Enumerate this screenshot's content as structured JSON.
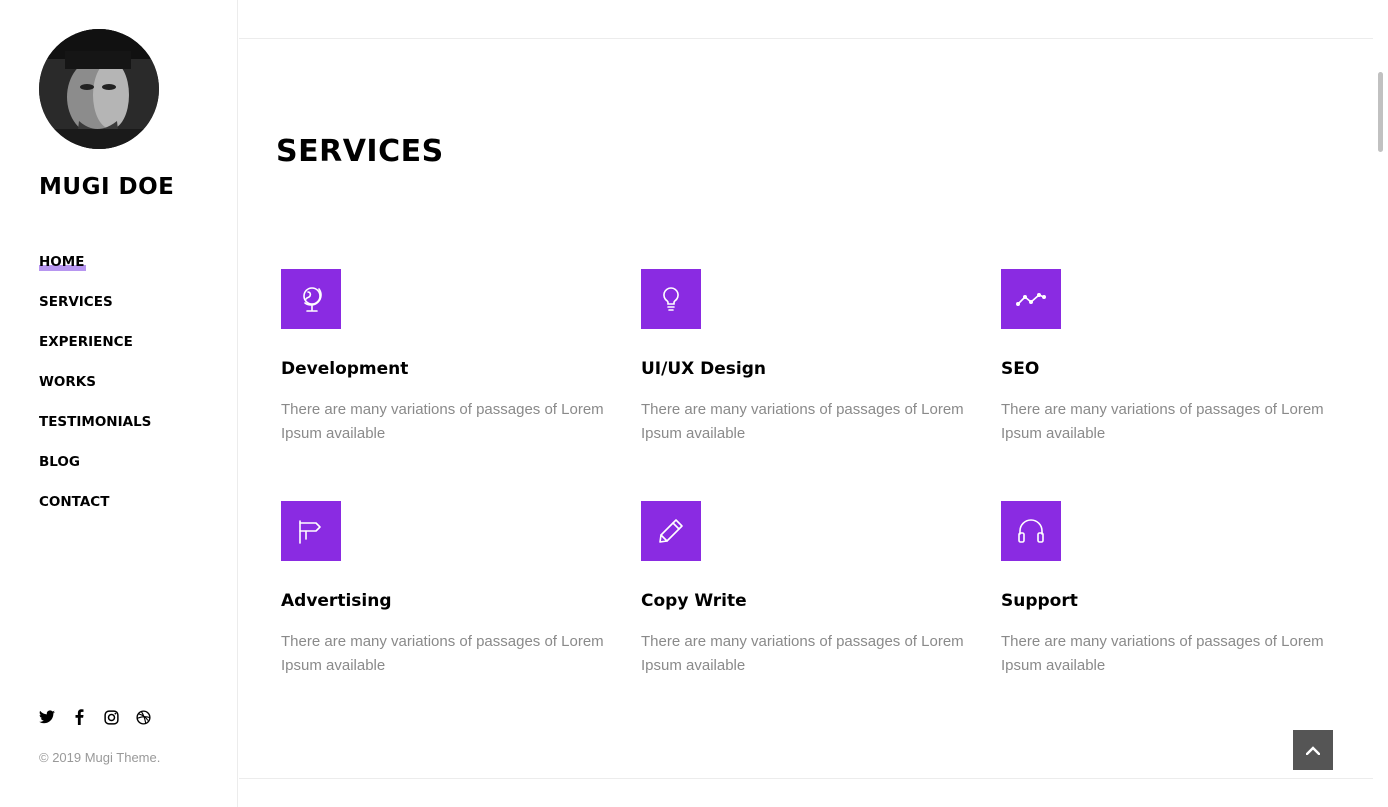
{
  "profile": {
    "name": "MUGI DOE",
    "avatar_alt": "profile photo"
  },
  "nav": {
    "items": [
      {
        "label": "HOME",
        "active": true
      },
      {
        "label": "SERVICES",
        "active": false
      },
      {
        "label": "EXPERIENCE",
        "active": false
      },
      {
        "label": "WORKS",
        "active": false
      },
      {
        "label": "TESTIMONIALS",
        "active": false
      },
      {
        "label": "BLOG",
        "active": false
      },
      {
        "label": "CONTACT",
        "active": false
      }
    ]
  },
  "social": [
    "twitter-icon",
    "facebook-icon",
    "instagram-icon",
    "dribbble-icon"
  ],
  "footer": {
    "copyright": "© 2019 Mugi Theme."
  },
  "section": {
    "title": "SERVICES"
  },
  "services": [
    {
      "title": "Development",
      "description": "There are many variations of passages of Lorem Ipsum available",
      "icon": "globe-icon"
    },
    {
      "title": "UI/UX Design",
      "description": "There are many variations of passages of Lorem Ipsum available",
      "icon": "lightbulb-icon"
    },
    {
      "title": "SEO",
      "description": "There are many variations of passages of Lorem Ipsum available",
      "icon": "trend-line-icon"
    },
    {
      "title": "Advertising",
      "description": "There are many variations of passages of Lorem Ipsum available",
      "icon": "signpost-icon"
    },
    {
      "title": "Copy Write",
      "description": "There are many variations of passages of Lorem Ipsum available",
      "icon": "pencil-icon"
    },
    {
      "title": "Support",
      "description": "There are many variations of passages of Lorem Ipsum available",
      "icon": "headphones-icon"
    }
  ],
  "colors": {
    "accent": "#8a2be2",
    "highlight": "#7b3fe4",
    "muted_text": "#8a8a8a"
  }
}
